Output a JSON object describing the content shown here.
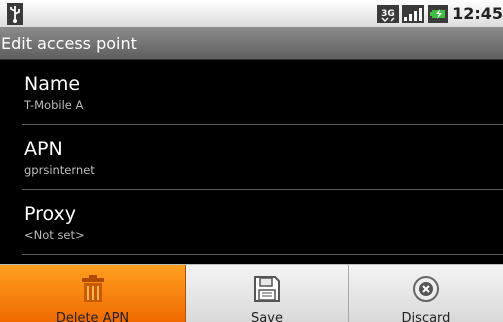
{
  "status_bar": {
    "time": "12:45",
    "icons": [
      "usb-icon",
      "3g-icon",
      "signal-bars-icon",
      "battery-icon"
    ]
  },
  "title": "Edit access point",
  "fields": [
    {
      "label": "Name",
      "value": "T-Mobile A"
    },
    {
      "label": "APN",
      "value": "gprsinternet"
    },
    {
      "label": "Proxy",
      "value": "<Not set>"
    }
  ],
  "menu": {
    "items": [
      {
        "label": "Delete APN",
        "icon": "trash-icon",
        "selected": true
      },
      {
        "label": "Save",
        "icon": "floppy-disk-icon",
        "selected": false
      },
      {
        "label": "Discard",
        "icon": "close-circle-icon",
        "selected": false
      }
    ]
  },
  "colors": {
    "selected_menu": "#f48a0c",
    "title_bar": "#6f6f6f",
    "list_background": "#000000"
  }
}
